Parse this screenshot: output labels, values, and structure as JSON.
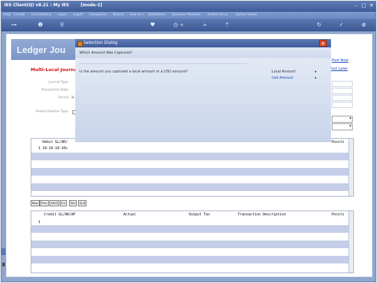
{
  "window": {
    "title": "IES Client(Q) v8.21 : My IES        [mode-2]",
    "minimize": "–",
    "maximize": "□",
    "close": "✕"
  },
  "menu": [
    "Help",
    "Infolab",
    "Connections",
    "Logon",
    "Logoff",
    "Companies",
    "Wizard",
    "How do I",
    "DataMarts",
    "Business Modules",
    "Action Focus",
    "Option Select"
  ],
  "toolbar": {
    "icons": [
      "key-icon",
      "info-icon",
      "search-icon",
      "heart-icon",
      "clock-icon",
      "back-icon",
      "forward-icon",
      "upload-icon",
      "refresh-icon",
      "check-icon",
      "close-icon"
    ]
  },
  "page": {
    "header": "Ledger Jou",
    "red_title": "Multi-Local Journal",
    "post_now": "Post Now",
    "post_later": "Post Later",
    "labels": {
      "journal_type": "Journal Type",
      "transaction_date": "Transaction Date",
      "period": "Period",
      "period_value": "3/",
      "posted_position_type": "Posted Position Type"
    },
    "debit_grid": {
      "col1": "Debit GL/AR/",
      "col_right": "Positi",
      "row_num": "1",
      "row_value": "10-10-10-10c"
    },
    "mini_buttons": [
      "New",
      "Prev",
      "Add1",
      "Ins",
      "Del",
      "Quit"
    ],
    "credit_grid": {
      "col1": "Credit GL/AR/AP",
      "col2": "Actual",
      "col3": "Output Tax",
      "col4": "Transaction Description",
      "col5": "Positi",
      "row_num": "1"
    }
  },
  "dialog": {
    "title": "Selection Dialog",
    "subtitle": "Which Amount Was Captured?",
    "question": "Is the amount you captured a local amount or a USD amount?",
    "options": [
      {
        "label": "Local Amount",
        "arrow": "▸"
      },
      {
        "label": "Usd Amount",
        "arrow": "▸"
      }
    ],
    "close": "✕"
  }
}
